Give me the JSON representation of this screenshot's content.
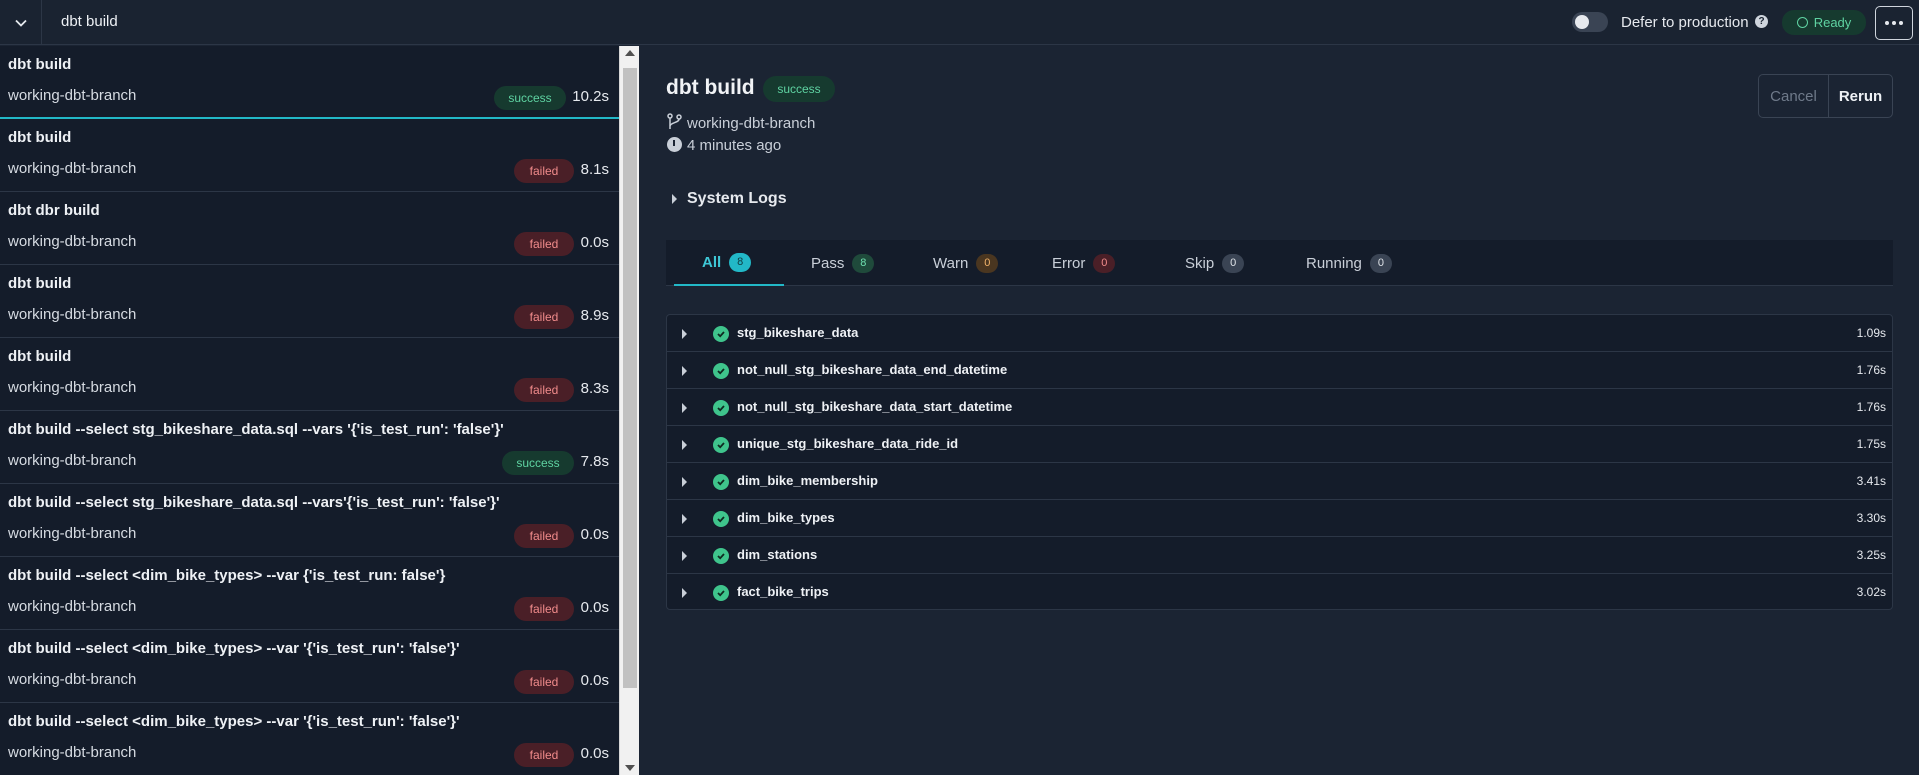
{
  "topbar": {
    "title": "dbt build",
    "defer_label": "Defer to production",
    "help": "?",
    "ready_label": "Ready"
  },
  "runs": [
    {
      "cmd": "dbt build",
      "branch": "working-dbt-branch",
      "status": "success",
      "duration": "10.2s"
    },
    {
      "cmd": "dbt build",
      "branch": "working-dbt-branch",
      "status": "failed",
      "duration": "8.1s"
    },
    {
      "cmd": "dbt dbr build",
      "branch": "working-dbt-branch",
      "status": "failed",
      "duration": "0.0s"
    },
    {
      "cmd": "dbt build",
      "branch": "working-dbt-branch",
      "status": "failed",
      "duration": "8.9s"
    },
    {
      "cmd": "dbt build",
      "branch": "working-dbt-branch",
      "status": "failed",
      "duration": "8.3s"
    },
    {
      "cmd": "dbt build --select stg_bikeshare_data.sql --vars '{'is_test_run': 'false'}'",
      "branch": "working-dbt-branch",
      "status": "success",
      "duration": "7.8s"
    },
    {
      "cmd": "dbt build --select stg_bikeshare_data.sql --vars'{'is_test_run': 'false'}'",
      "branch": "working-dbt-branch",
      "status": "failed",
      "duration": "0.0s"
    },
    {
      "cmd": "dbt build --select <dim_bike_types> --var {'is_test_run: false'}",
      "branch": "working-dbt-branch",
      "status": "failed",
      "duration": "0.0s"
    },
    {
      "cmd": "dbt build --select <dim_bike_types> --var '{'is_test_run': 'false'}'",
      "branch": "working-dbt-branch",
      "status": "failed",
      "duration": "0.0s"
    },
    {
      "cmd": "dbt build --select <dim_bike_types> --var '{'is_test_run': 'false'}'",
      "branch": "working-dbt-branch",
      "status": "failed",
      "duration": "0.0s"
    }
  ],
  "detail": {
    "title": "dbt build",
    "status": "success",
    "branch": "working-dbt-branch",
    "time_ago": "4 minutes ago",
    "cancel_label": "Cancel",
    "rerun_label": "Rerun",
    "system_logs": "System Logs",
    "tabs": [
      {
        "label": "All",
        "count": "8"
      },
      {
        "label": "Pass",
        "count": "8"
      },
      {
        "label": "Warn",
        "count": "0"
      },
      {
        "label": "Error",
        "count": "0"
      },
      {
        "label": "Skip",
        "count": "0"
      },
      {
        "label": "Running",
        "count": "0"
      }
    ],
    "nodes": [
      {
        "name": "stg_bikeshare_data",
        "duration": "1.09s"
      },
      {
        "name": "not_null_stg_bikeshare_data_end_datetime",
        "duration": "1.76s"
      },
      {
        "name": "not_null_stg_bikeshare_data_start_datetime",
        "duration": "1.76s"
      },
      {
        "name": "unique_stg_bikeshare_data_ride_id",
        "duration": "1.75s"
      },
      {
        "name": "dim_bike_membership",
        "duration": "3.41s"
      },
      {
        "name": "dim_bike_types",
        "duration": "3.30s"
      },
      {
        "name": "dim_stations",
        "duration": "3.25s"
      },
      {
        "name": "fact_bike_trips",
        "duration": "3.02s"
      }
    ]
  },
  "colors": {
    "accent": "#22b8c7",
    "success": "#5fd3a2",
    "failed": "#f08b8b",
    "background": "#1b2433"
  }
}
